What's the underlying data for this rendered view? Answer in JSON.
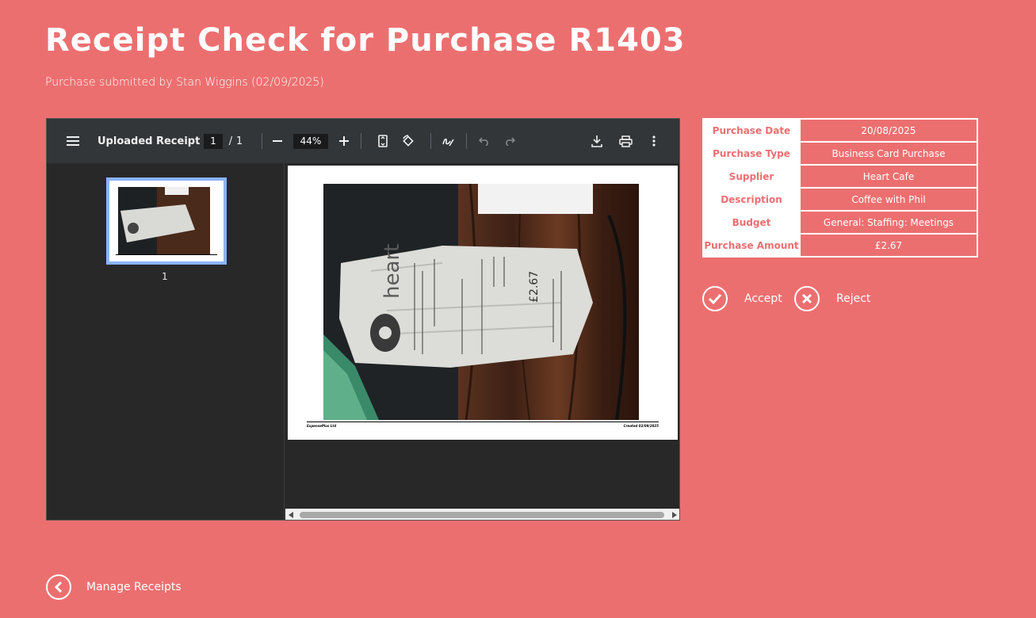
{
  "header": {
    "title": "Receipt Check for Purchase R1403",
    "subtitle": "Purchase submitted by Stan Wiggins (02/09/2025)"
  },
  "viewer": {
    "title": "Uploaded Receipt",
    "current_page": "1",
    "page_sep": "/",
    "total_pages": "1",
    "zoom": "44%",
    "thumb_label": "1",
    "footer_left": "ExpensePlus Ltd",
    "footer_right": "Created 02/09/2025",
    "receipt_brand": "heart",
    "receipt_total": "£2.67"
  },
  "details": [
    {
      "label": "Purchase Date",
      "value": "20/08/2025"
    },
    {
      "label": "Purchase Type",
      "value": "Business Card Purchase"
    },
    {
      "label": "Supplier",
      "value": "Heart Cafe"
    },
    {
      "label": "Description",
      "value": "Coffee with Phil"
    },
    {
      "label": "Budget",
      "value": "General: Staffing: Meetings"
    },
    {
      "label": "Purchase Amount",
      "value": "£2.67"
    }
  ],
  "actions": {
    "accept_label": "Accept",
    "reject_label": "Reject"
  },
  "nav": {
    "back_label": "Manage Receipts"
  },
  "colors": {
    "background": "#ec6f70",
    "viewer_toolbar": "#323639",
    "viewer_body": "#282828",
    "thumb_highlight": "#8ab4f8"
  },
  "icons": [
    "menu-icon",
    "zoom-out-icon",
    "zoom-in-icon",
    "fit-page-icon",
    "rotate-icon",
    "annotate-icon",
    "undo-icon",
    "redo-icon",
    "download-icon",
    "print-icon",
    "more-vert-icon",
    "check-icon",
    "close-icon",
    "chevron-left-icon"
  ]
}
